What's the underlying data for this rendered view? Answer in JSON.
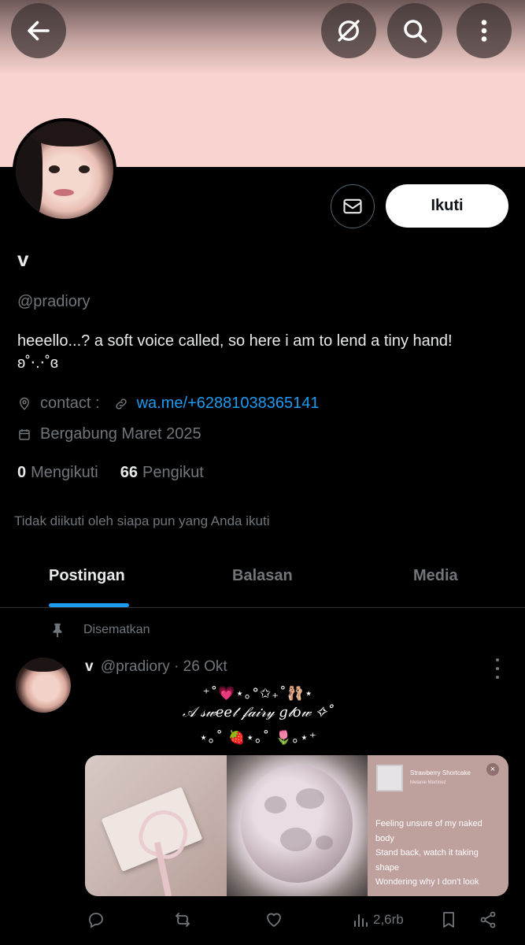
{
  "header": {
    "back_icon": "arrow-left-icon",
    "grok_icon": "grok-icon",
    "search_icon": "search-icon",
    "more_icon": "more-vertical-icon",
    "banner_color": "#f8d3cf"
  },
  "profile": {
    "display_name": "v",
    "handle": "@pradiory",
    "bio_line1": "heeello...? a soft voice called, so here i am to lend a tiny hand!",
    "bio_line2": "ʚ˚⋅.⋅˚ɞ",
    "location_label": "contact :",
    "link_text": "wa.me/+62881038365141",
    "joined": "Bergabung Maret 2025",
    "following_count": "0",
    "following_label": "Mengikuti",
    "followers_count": "66",
    "followers_label": "Pengikut",
    "not_followed_text": "Tidak diikuti oleh siapa pun yang Anda ikuti",
    "follow_button": "Ikuti",
    "accent_color": "#1d9bf0"
  },
  "tabs": [
    {
      "label": "Postingan",
      "active": true
    },
    {
      "label": "Balasan",
      "active": false
    },
    {
      "label": "Media",
      "active": false
    }
  ],
  "post": {
    "pinned_label": "Disematkan",
    "author_name": "v",
    "author_handle": "@pradiory",
    "date": "· 26 Okt",
    "deco_line1": "⁺˚💗⋆｡°✩₊˚🩰⋆",
    "deco_line2": "𝒜 𝓈𝓌𝑒𝑒𝓉 𝒻𝒶𝒾𝓇𝓎 𝑔𝓁𝑜𝓌 ✧˚",
    "deco_line3": "⋆｡˚ 🍓⋆｡˚ 🌷｡⋆⁺",
    "song_title": "Strawberry Shortcake",
    "song_artist": "Melanie Martinez",
    "lyrics_1": "Feeling unsure of my naked body",
    "lyrics_2": "Stand back, watch it taking shape",
    "lyrics_3": "Wondering why I don't look",
    "views": "2,6rb"
  }
}
